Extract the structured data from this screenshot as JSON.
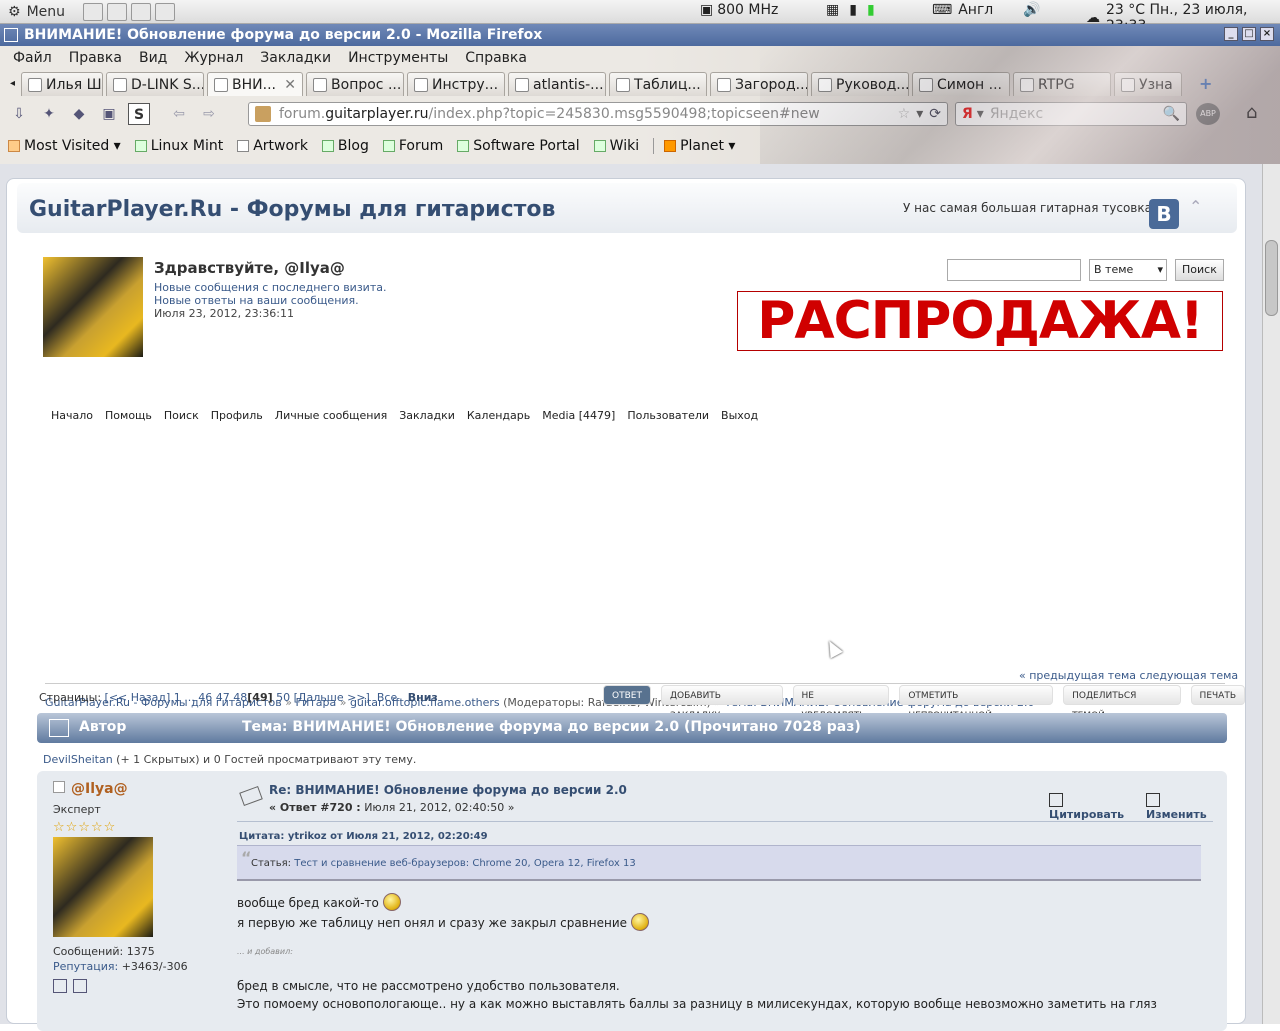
{
  "panel": {
    "menu_label": "Menu",
    "cpu": "800 MHz",
    "lang": "Англ",
    "clock": "23 °C Пн., 23 июля, 23:33"
  },
  "window": {
    "title": "ВНИМАНИЕ! Обновление форума до версии 2.0 - Mozilla Firefox"
  },
  "menubar": [
    "Файл",
    "Правка",
    "Вид",
    "Журнал",
    "Закладки",
    "Инструменты",
    "Справка"
  ],
  "tabs": [
    "Илья Ш...",
    "D-LINK S...",
    "ВНИ...",
    "Вопрос ...",
    "Инстру...",
    "atlantis-...",
    "Таблиц...",
    "Загород...",
    "Руковод...",
    "Симон ...",
    "RTPG",
    "Узна"
  ],
  "urlbar": {
    "prefix": "forum.",
    "domain": "guitarplayer.ru",
    "path": "/index.php?topic=245830.msg5590498;topicseen#new"
  },
  "searchbar": {
    "placeholder": "Яндекс"
  },
  "bookmarks": [
    "Most Visited",
    "Linux Mint",
    "Artwork",
    "Blog",
    "Forum",
    "Software Portal",
    "Wiki",
    "Planet"
  ],
  "forum": {
    "site_title": "GuitarPlayer.Ru - Форумы для гитаристов",
    "slogan": "У нас самая большая гитарная тусовка",
    "vk": "B",
    "greeting": "Здравствуйте, @Ilya@",
    "new_posts": "Новые сообщения с последнего визита.",
    "new_replies": "Новые ответы на ваши сообщения.",
    "date": "Июля 23, 2012, 23:36:11",
    "search_scope": "В теме",
    "search_button": "Поиск",
    "banner": "РАСПРОДАЖА!",
    "menu": [
      "Начало",
      "Помощь",
      "Поиск",
      "Профиль",
      "Личные сообщения",
      "Закладки",
      "Календарь",
      "Media [4479]",
      "Пользователи",
      "Выход"
    ],
    "breadcrumb": {
      "c1": "GuitarPlayer.Ru - Форумы для гитаристов",
      "c2": "Гитара",
      "c3": "guitar.offtopic.flame.others",
      "mods": "(Модераторы: RafaelRS, Wintercalm)",
      "c4": "Тема: ВНИМАНИЕ! Обновление форума до версии 2.0"
    },
    "nextprev": "« предыдущая тема следующая тема »",
    "pages": {
      "label": "Страницы:",
      "back": "[<< Назад]",
      "p1": "1",
      "dots": "...",
      "p46": "46",
      "p47": "47",
      "p48": "48",
      "current": "[49]",
      "p50": "50",
      "next": "[Дальше >>]",
      "all": "Все",
      "down": "Вниз"
    },
    "buttons": [
      "ОТВЕТ",
      "ДОБАВИТЬ ЗАКЛАДКУ",
      "НЕ УВЕДОМЛЯТЬ",
      "ОТМЕТИТЬ НЕПРОЧИТАННОЙ",
      "ПОДЕЛИТЬСЯ ТЕМОЙ",
      "ПЕЧАТЬ"
    ],
    "catbar": {
      "author": "Автор",
      "topic": "Тема: ВНИМАНИЕ! Обновление форума до версии 2.0  (Прочитано 7028 раз)"
    },
    "viewers": {
      "user": "DevilSheitan",
      "rest": " (+ 1 Скрытых) и 0 Гостей просматривают эту тему."
    },
    "post": {
      "poster": "@Ilya@",
      "rank": "Эксперт",
      "stars": "☆☆☆☆☆",
      "messages": "Сообщений: 1375",
      "rep_label": "Репутация:",
      "rep_value": " +3463/-306",
      "subject": "Re: ВНИМАНИЕ! Обновление форума до версии 2.0",
      "reply_no": "« Ответ #720 :",
      "reply_date": " Июля 21, 2012, 02:40:50 »",
      "quote_btn": "Цитировать",
      "edit_btn": "Изменить",
      "quote_header": "Цитата: ytrikoz от Июля 21, 2012, 02:20:49",
      "quote_prefix": "Статья: ",
      "quote_link": "Тест и сравнение веб-браузеров: Chrome 20, Opera 12, Firefox 13",
      "line1": "вообще бред какой-то",
      "line2": "я первую же таблицу неп онял и сразу же закрыл сравнение",
      "added": "... и добавил:",
      "line3": "бред в смысле, что не рассмотрено удобство пользователя.",
      "line4": "Это помоему основопологающе.. ну а как можно выставлять баллы за разницу в милисекундах, которую вообще невозможно заметить на гляз"
    }
  }
}
